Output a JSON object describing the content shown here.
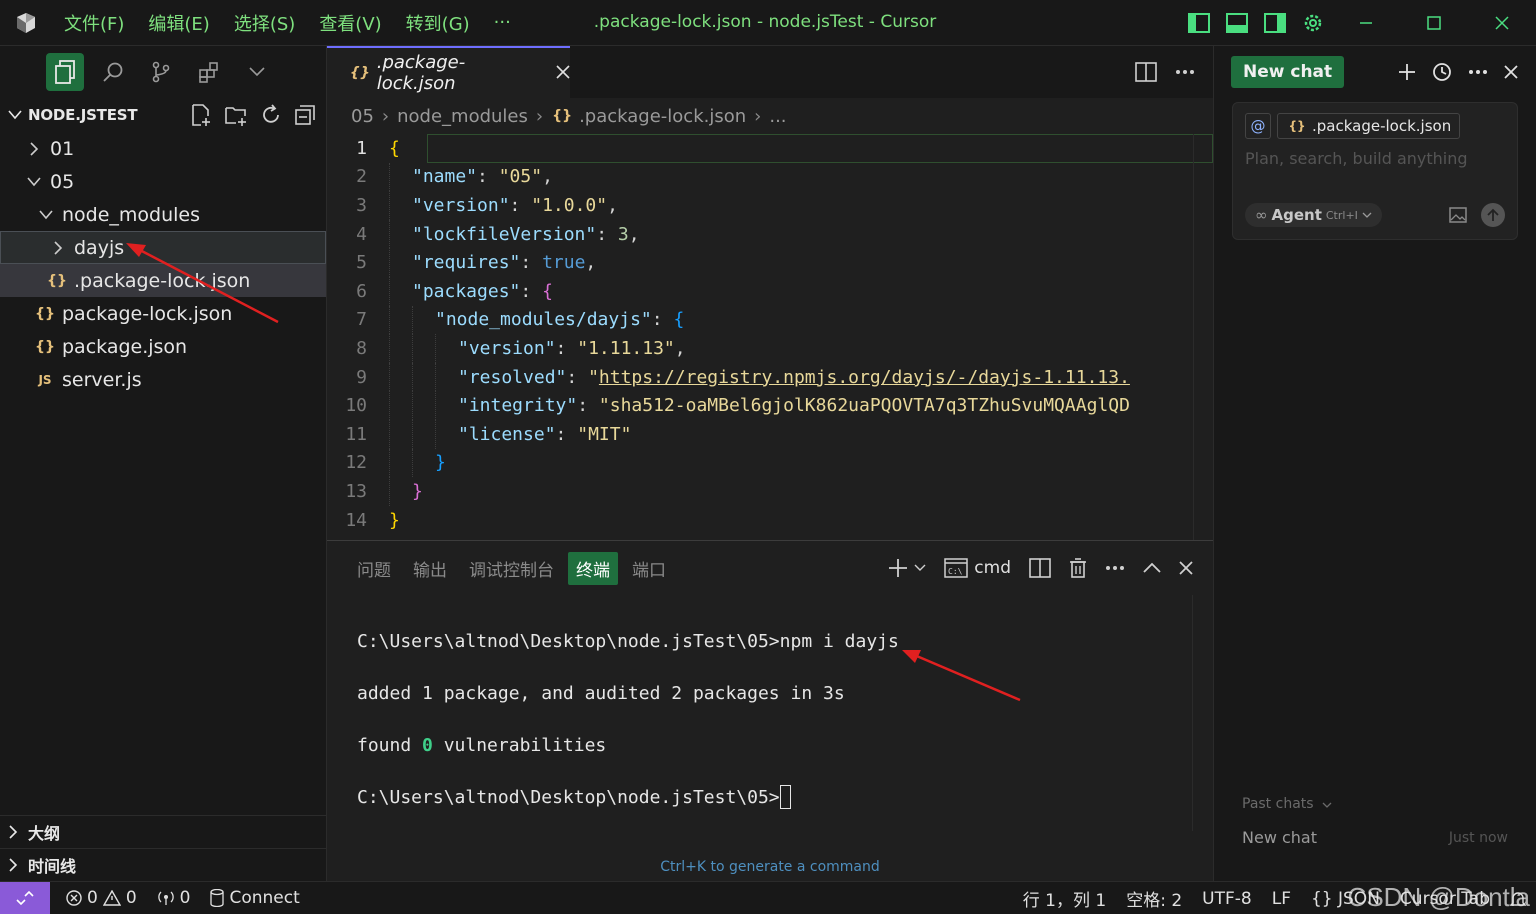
{
  "titlebar": {
    "menus": [
      "文件(F)",
      "编辑(E)",
      "选择(S)",
      "查看(V)",
      "转到(G)",
      "···"
    ],
    "title": ".package-lock.json - node.jsTest - Cursor"
  },
  "sidebar": {
    "section_title": "NODE.JSTEST",
    "tree": [
      {
        "label": "01",
        "icon": "chevron-right-icon"
      },
      {
        "label": "05",
        "icon": "chevron-down-icon"
      },
      {
        "label": "node_modules",
        "icon": "chevron-down-icon"
      },
      {
        "label": "dayjs",
        "icon": "chevron-right-icon"
      },
      {
        "label": ".package-lock.json",
        "icon": "{}"
      },
      {
        "label": "package-lock.json",
        "icon": "{}"
      },
      {
        "label": "package.json",
        "icon": "{}"
      },
      {
        "label": "server.js",
        "icon": "JS"
      }
    ],
    "outline_label": "大纲",
    "timeline_label": "时间线"
  },
  "editor": {
    "tab_label": ".package-lock.json",
    "breadcrumb": [
      "05",
      "node_modules",
      ".package-lock.json",
      "..."
    ],
    "line_numbers": [
      "1",
      "2",
      "3",
      "4",
      "5",
      "6",
      "7",
      "8",
      "9",
      "10",
      "11",
      "12",
      "13",
      "14"
    ],
    "code": {
      "l2_key": "\"name\"",
      "l2_val": "\"05\"",
      "l3_key": "\"version\"",
      "l3_val": "\"1.0.0\"",
      "l4_key": "\"lockfileVersion\"",
      "l4_val": "3",
      "l5_key": "\"requires\"",
      "l5_val": "true",
      "l6_key": "\"packages\"",
      "l7_key": "\"node_modules/dayjs\"",
      "l8_key": "\"version\"",
      "l8_val": "\"1.11.13\"",
      "l9_key": "\"resolved\"",
      "l9_val": "https://registry.npmjs.org/dayjs/-/dayjs-1.11.13.",
      "l10_key": "\"integrity\"",
      "l10_val": "\"sha512-oaMBel6gjolK862uaPQOVTA7q3TZhuSvuMQAAglQD",
      "l11_key": "\"license\"",
      "l11_val": "\"MIT\""
    }
  },
  "panel": {
    "tabs": [
      "问题",
      "输出",
      "调试控制台",
      "终端",
      "端口"
    ],
    "active_tab": "终端",
    "shell_label": "cmd",
    "terminal_lines": {
      "cmd": "C:\\Users\\altnod\\Desktop\\node.jsTest\\05>npm i dayjs",
      "added": "added 1 package, and audited 2 packages in 3s",
      "found_pre": "found ",
      "found_num": "0",
      "found_post": " vulnerabilities",
      "prompt": "C:\\Users\\altnod\\Desktop\\node.jsTest\\05>"
    },
    "hint": "Ctrl+K to generate a command"
  },
  "chat": {
    "tab_label": "New chat",
    "context_file": ".package-lock.json",
    "placeholder": "Plan, search, build anything",
    "mode_label": "Agent",
    "mode_shortcut": "Ctrl+I",
    "past_chats_label": "Past chats",
    "history_title": "New chat",
    "history_time": "Just now"
  },
  "statusbar": {
    "errors": "0",
    "warnings": "0",
    "ports": "0",
    "connect": "Connect",
    "position": "行 1，列 1",
    "spaces": "空格: 2",
    "encoding": "UTF-8",
    "eol": "LF",
    "language": "{} JSON",
    "cursor_tab": "Cursor Tab"
  },
  "watermark": "CSDN @Dontla",
  "colors": {
    "accent_green": "#1f6f3e",
    "menu_green": "#7ee07e",
    "annotation_red": "#e02020"
  }
}
